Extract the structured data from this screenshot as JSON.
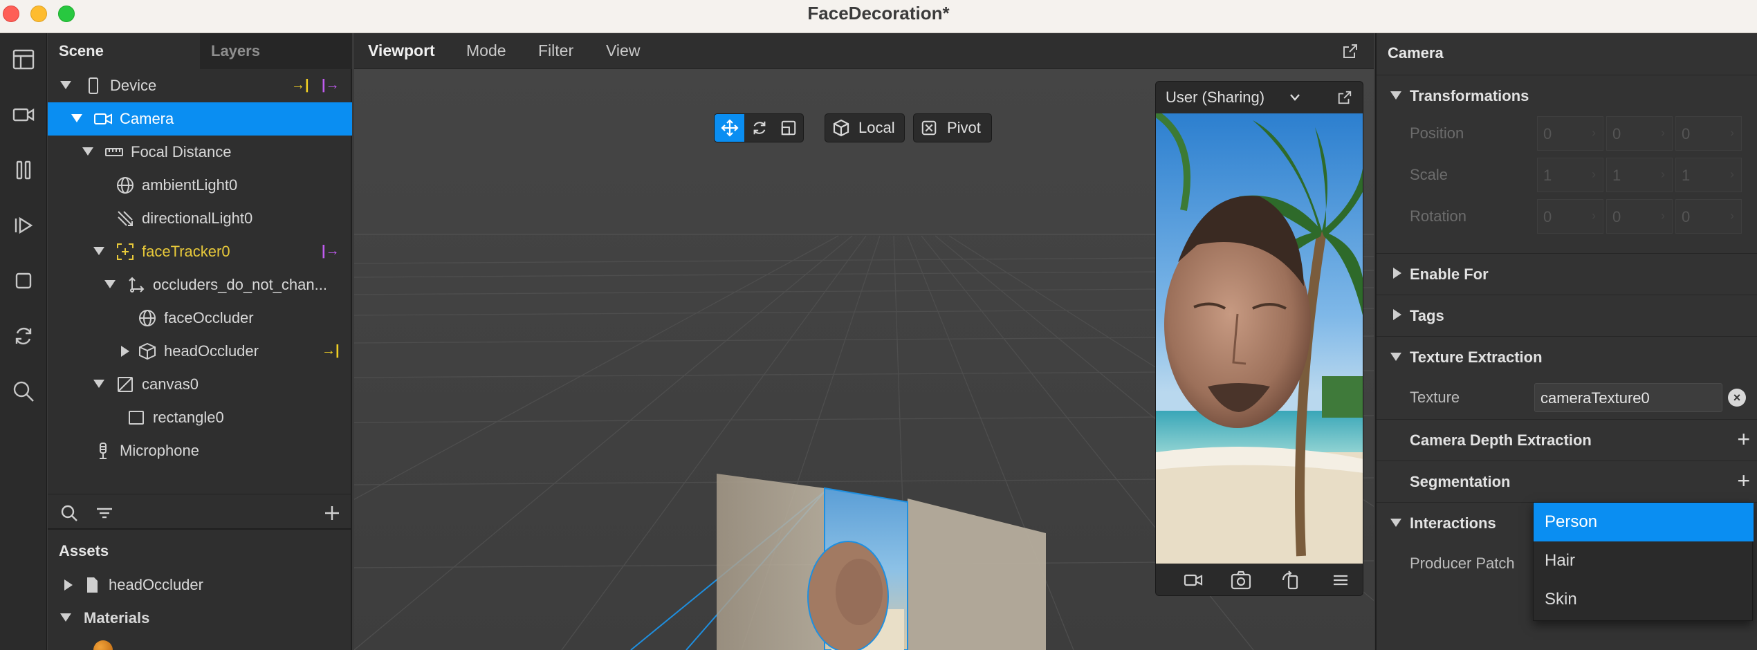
{
  "window": {
    "title": "FaceDecoration*"
  },
  "scene_panel": {
    "tabs": [
      "Scene",
      "Layers"
    ],
    "tree": [
      {
        "label": "Device",
        "icon": "phone-icon",
        "markers": [
          "→|",
          "|→"
        ]
      },
      {
        "label": "Camera",
        "icon": "camera-icon",
        "selected": true
      },
      {
        "label": "Focal Distance",
        "icon": "ruler-icon"
      },
      {
        "label": "ambientLight0",
        "icon": "globe-icon"
      },
      {
        "label": "directionalLight0",
        "icon": "directional-light-icon"
      },
      {
        "label": "faceTracker0",
        "icon": "face-tracker-icon",
        "markers": [
          "|→"
        ]
      },
      {
        "label": "occluders_do_not_chan...",
        "icon": "null-object-icon"
      },
      {
        "label": "faceOccluder",
        "icon": "globe-icon"
      },
      {
        "label": "headOccluder",
        "icon": "cube-icon",
        "markers": [
          "→|"
        ]
      },
      {
        "label": "canvas0",
        "icon": "canvas-icon"
      },
      {
        "label": "rectangle0",
        "icon": "rectangle-icon"
      },
      {
        "label": "Microphone",
        "icon": "microphone-icon"
      }
    ],
    "assets_title": "Assets",
    "assets": [
      {
        "label": "headOccluder",
        "icon": "file-icon"
      },
      {
        "label": "Materials",
        "icon": "folder-icon"
      }
    ]
  },
  "viewport": {
    "menu": [
      "Viewport",
      "Mode",
      "Filter",
      "View"
    ],
    "toolbar": {
      "local_label": "Local",
      "pivot_label": "Pivot"
    },
    "preview": {
      "device_label": "User (Sharing)"
    }
  },
  "inspector": {
    "title": "Camera",
    "transformations": {
      "title": "Transformations",
      "rows": [
        {
          "label": "Position",
          "values": [
            "0",
            "0",
            "0"
          ]
        },
        {
          "label": "Scale",
          "values": [
            "1",
            "1",
            "1"
          ]
        },
        {
          "label": "Rotation",
          "values": [
            "0",
            "0",
            "0"
          ]
        }
      ]
    },
    "sections": {
      "enable_for": "Enable For",
      "tags": "Tags",
      "texture_extraction": "Texture Extraction",
      "camera_depth": "Camera Depth Extraction",
      "segmentation": "Segmentation",
      "interactions": "Interactions"
    },
    "texture": {
      "label": "Texture",
      "value": "cameraTexture0"
    },
    "producer_patch_label": "Producer Patch",
    "dropdown_options": [
      "Person",
      "Hair",
      "Skin"
    ]
  },
  "colors": {
    "accent": "#0a8ef2",
    "marker_yellow": "#f2d024",
    "marker_purple": "#c05cf0",
    "tracker_text": "#e8c93a"
  }
}
